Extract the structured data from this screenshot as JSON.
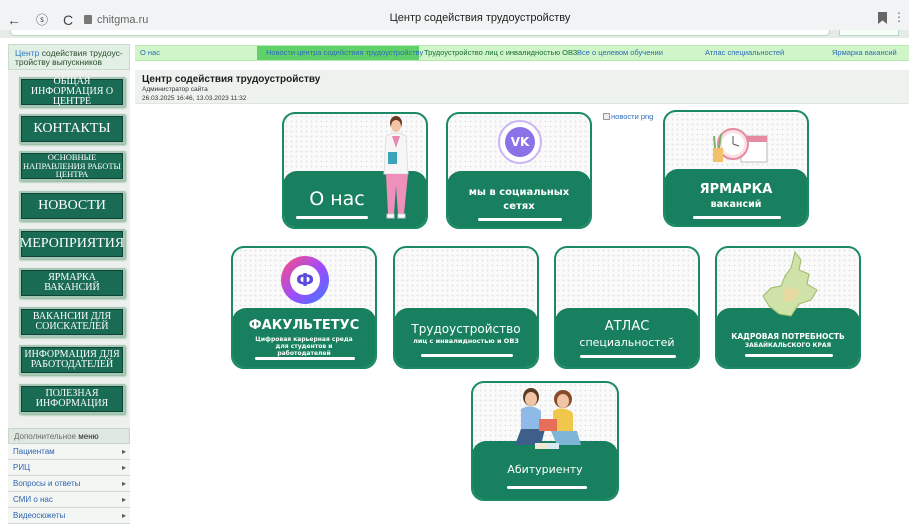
{
  "browser": {
    "back": "←",
    "ext": "ⓢ",
    "reload": "C",
    "url": "chitgma.ru",
    "title": "Центр содействия трудоустройству",
    "more": "⋮"
  },
  "sidebar": {
    "head_light": "Центр",
    "head_rest": " содействия трудоус-тройству выпускников",
    "buttons": [
      "ОБЩАЯ ИНФОРМАЦИЯ О ЦЕНТРЕ",
      "КОНТАКТЫ",
      "ОСНОВНЫЕ НАПРАВЛЕНИЯ РАБОТЫ ЦЕНТРА",
      "НОВОСТИ",
      "МЕРОПРИЯТИЯ",
      "ЯРМАРКА ВАКАНСИЙ",
      "ВАКАНСИИ ДЛЯ СОИСКАТЕЛЕЙ",
      "ИНФОРМАЦИЯ ДЛЯ РАБОТОДАТЕЛЕЙ",
      "ПОЛЕЗНАЯ ИНФОРМАЦИЯ"
    ],
    "extra_head_light": "Дополнительное ",
    "extra_head_dark": "меню",
    "extra_items": [
      "Пациентам",
      "РИЦ",
      "Вопросы и ответы",
      "СМИ о нас",
      "Видеосюжеты"
    ]
  },
  "topnav": [
    "О нас",
    "Новости центра содействия трудоустройству",
    "Трудоустройство лиц с инвалидностью ОВЗ",
    "Все о целевом обучении",
    "Атлас специальностей",
    "Ярмарка вакансий"
  ],
  "article": {
    "title": "Центр содействия трудоустройству",
    "author": "Администратор сайта",
    "dates": "26.03.2025 16:46, 13.03.2023 11:32"
  },
  "news_image_alt": "новости png",
  "cards": {
    "about": "О нас",
    "social": "мы в социальных сетях",
    "fair_title": "ЯРМАРКА",
    "fair_sub": "вакансий",
    "fakultetus_title": "ФАКУЛЬТЕТУС",
    "fakultetus_sub": "Цифровая карьерная среда для студентов и работодателей",
    "employment_title": "Трудоустройство",
    "employment_sub": "лиц с инвалидностью и ОВЗ",
    "atlas_title": "АТЛАС",
    "atlas_sub": "специальностей",
    "staffing_title": "КАДРОВАЯ ПОТРЕБНОСТЬ",
    "staffing_sub": "ЗАБАЙКАЛЬСКОГО КРАЯ",
    "applicant": "Абитуриенту",
    "vk_logo": "VK",
    "fak_logo": "Ф"
  },
  "colors": {
    "brand_green": "#19805f",
    "nav_green": "#cff5c8",
    "link_blue": "#2c6bb7"
  },
  "icons": [
    "back-arrow-icon",
    "extension-icon",
    "reload-icon",
    "lock-icon",
    "bookmark-icon",
    "more-icon",
    "chevron-right-icon"
  ]
}
